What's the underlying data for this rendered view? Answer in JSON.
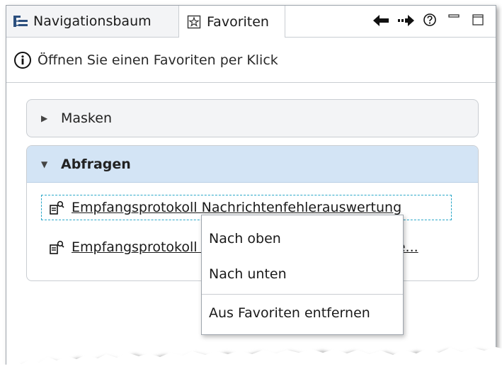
{
  "tabs": {
    "navigation_label": "Navigationsbaum",
    "favorites_label": "Favoriten"
  },
  "info": {
    "text": "Öffnen Sie einen Favoriten per Klick"
  },
  "sections": {
    "masken": {
      "label": "Masken",
      "expanded": false
    },
    "abfragen": {
      "label": "Abfragen",
      "expanded": true
    }
  },
  "items": [
    {
      "label": "Empfangsprotokoll Nachrichtenfehlerauswertung",
      "focused": true
    },
    {
      "label": "Empfangsprotokoll Nachrichtenauswertung der le...",
      "focused": false
    }
  ],
  "context_menu": {
    "move_up": "Nach oben",
    "move_down": "Nach unten",
    "remove": "Aus Favoriten entfernen"
  },
  "icons": {
    "tree": "tree-icon",
    "star": "star-icon",
    "back": "back-arrow-icon",
    "forward": "forward-arrow-icon",
    "help": "help-icon",
    "minimize": "minimize-icon",
    "maximize": "maximize-icon",
    "info": "info-icon",
    "query": "query-icon"
  },
  "colors": {
    "section_expanded_header": "#d3e4f5",
    "section_collapsed_bg": "#f3f4f6",
    "focus_border": "#2aa7c9",
    "border": "#c9cdd2"
  }
}
